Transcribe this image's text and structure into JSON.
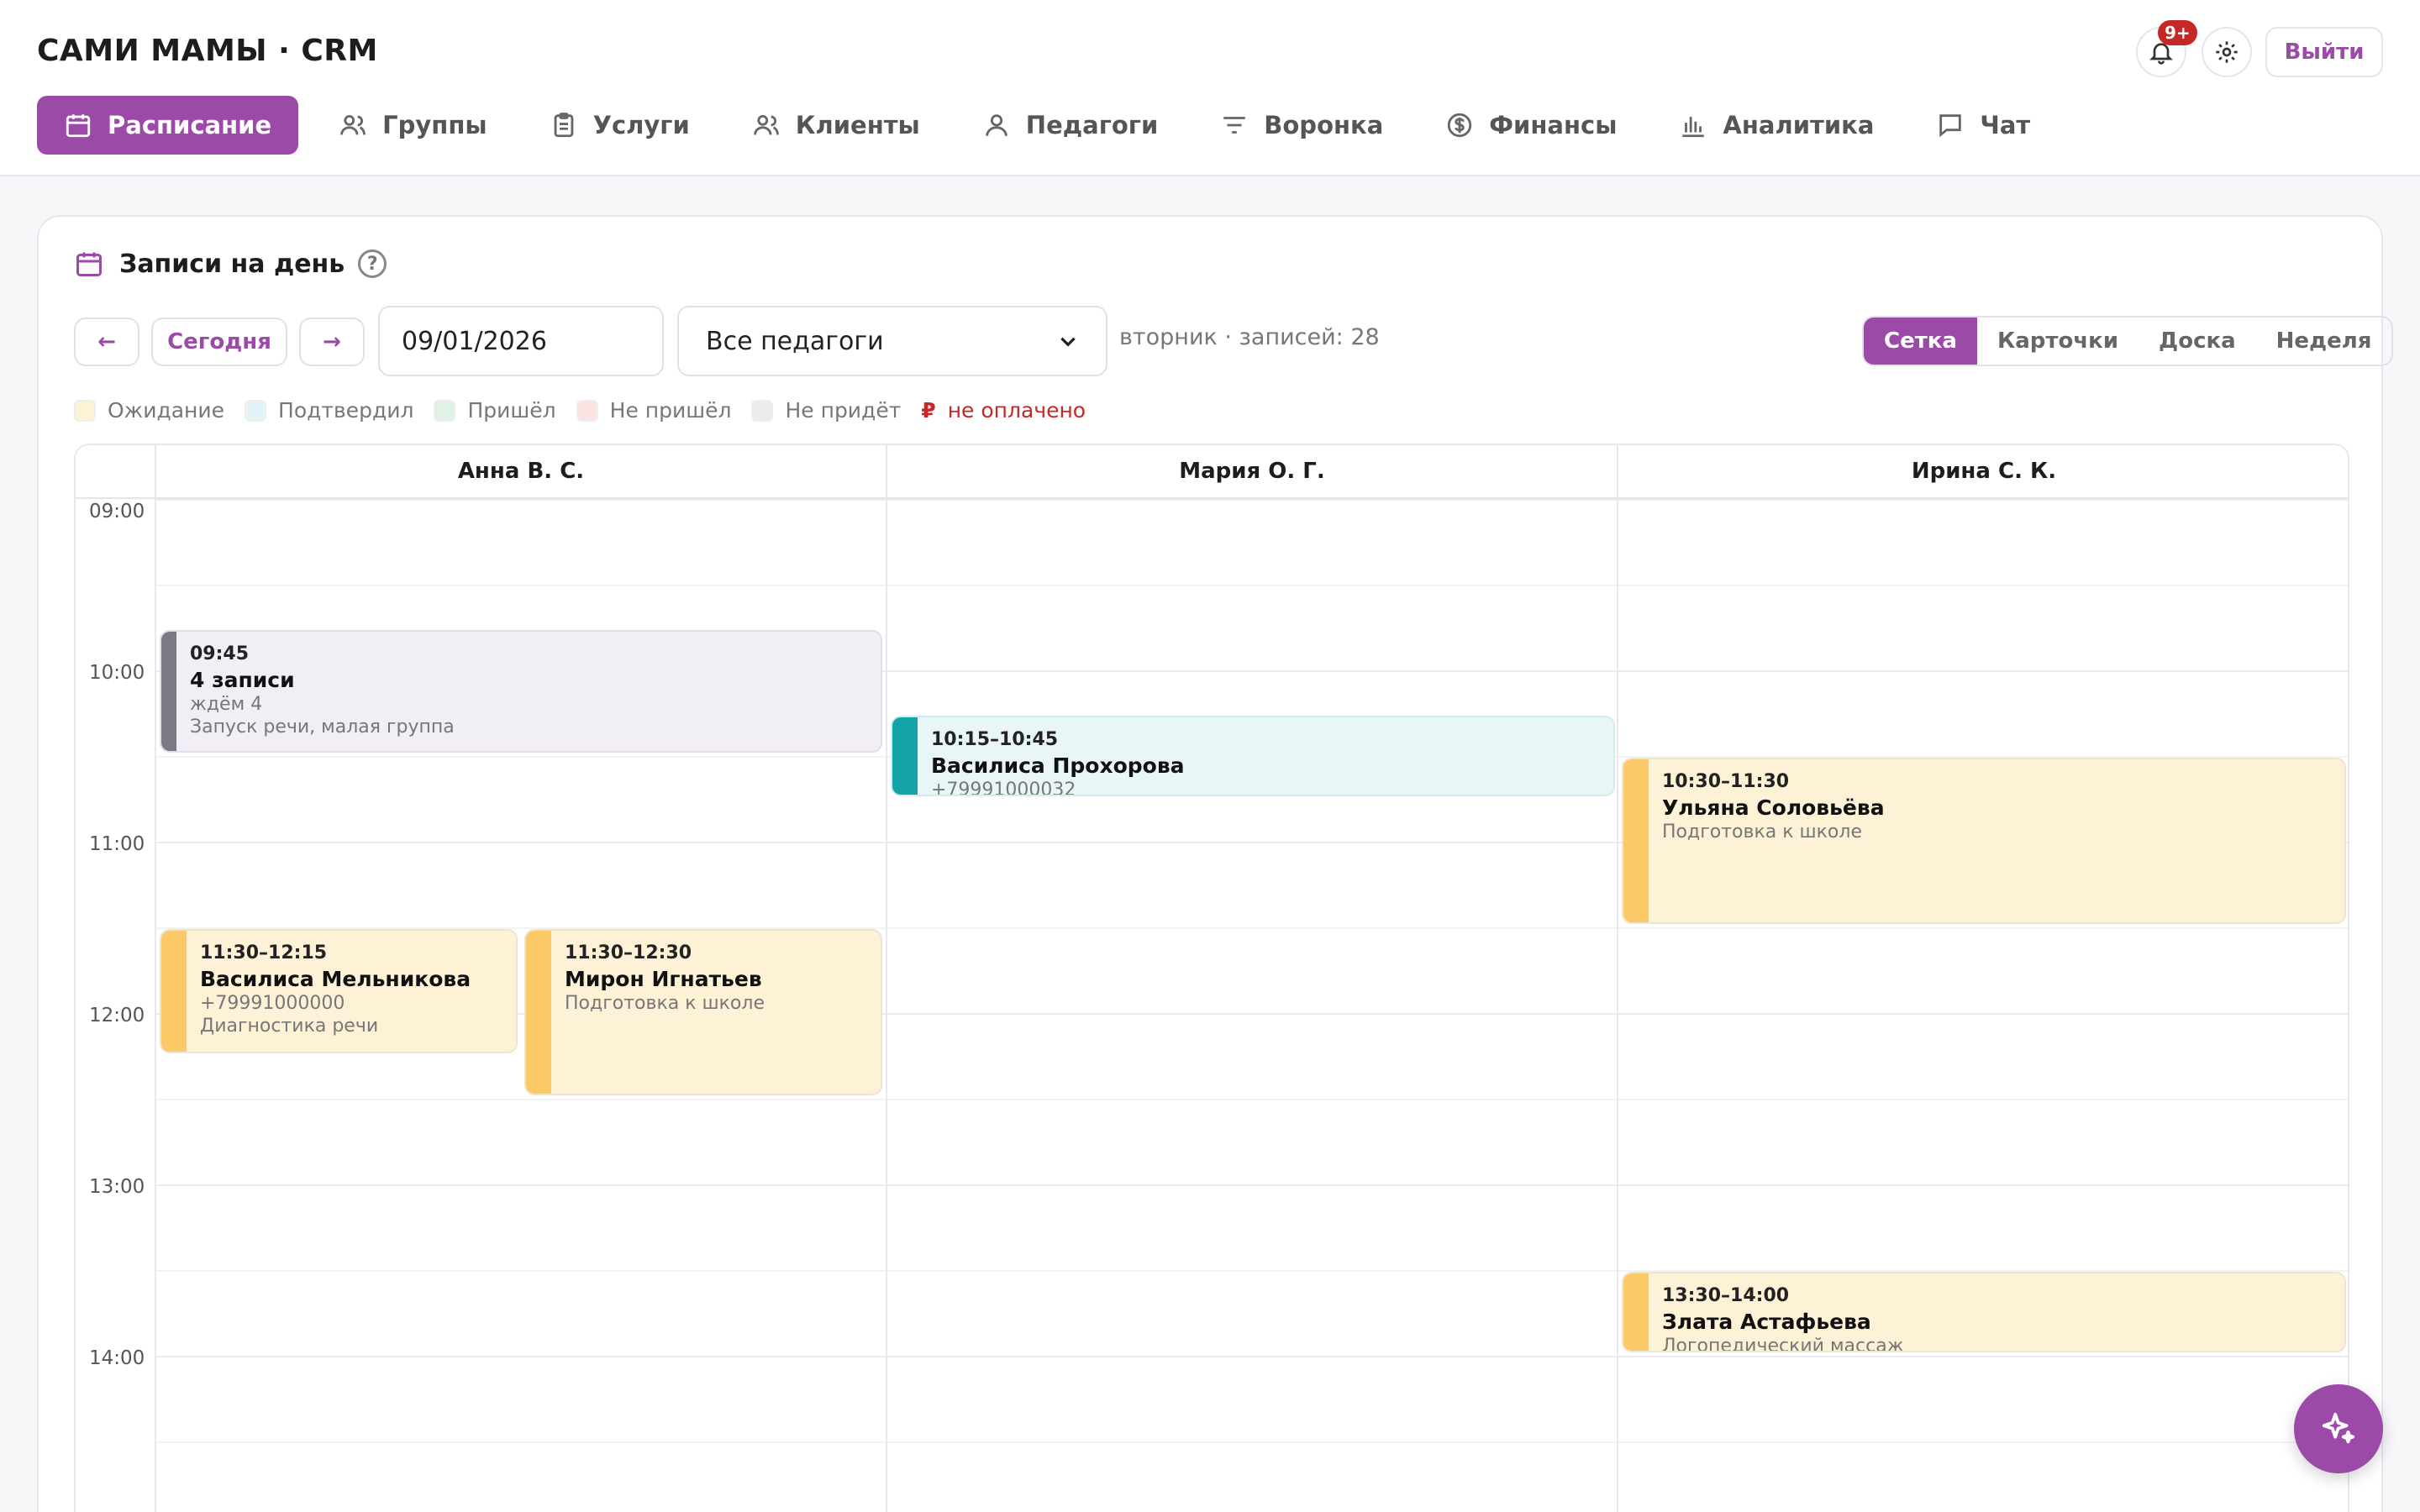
{
  "app": {
    "title": "САМИ МАМЫ · CRM"
  },
  "header": {
    "notifications_badge": "9+",
    "logout_label": "Выйти"
  },
  "nav": [
    {
      "label": "Расписание",
      "icon": "calendar-icon",
      "active": true
    },
    {
      "label": "Группы",
      "icon": "users-icon"
    },
    {
      "label": "Услуги",
      "icon": "clipboard-icon"
    },
    {
      "label": "Клиенты",
      "icon": "users-icon"
    },
    {
      "label": "Педагоги",
      "icon": "user-icon"
    },
    {
      "label": "Воронка",
      "icon": "filter-icon"
    },
    {
      "label": "Финансы",
      "icon": "dollar-icon"
    },
    {
      "label": "Аналитика",
      "icon": "bar-chart-icon"
    },
    {
      "label": "Чат",
      "icon": "chat-icon"
    }
  ],
  "card": {
    "title": "Записи на день",
    "help": "?"
  },
  "controls": {
    "prev": "←",
    "today": "Сегодня",
    "next": "→",
    "date_value": "09/01/2026",
    "teacher_select": "Все педагоги",
    "day_info": "вторник · записей: 28"
  },
  "views": {
    "grid": "Сетка",
    "cards": "Карточки",
    "board": "Доска",
    "week": "Неделя",
    "active": "Сетка"
  },
  "legend": {
    "items": [
      {
        "label": "Ожидание",
        "color": "#fdf1d6"
      },
      {
        "label": "Подтвердил",
        "color": "#e3f4f8"
      },
      {
        "label": "Пришёл",
        "color": "#e0f2e6"
      },
      {
        "label": "Не пришёл",
        "color": "#fbe3e3"
      },
      {
        "label": "Не придёт",
        "color": "#ececec"
      }
    ],
    "unpaid_symbol": "₽",
    "unpaid_label": "не оплачено"
  },
  "schedule": {
    "teachers": [
      "Анна В. С.",
      "Мария О. Г.",
      "Ирина С. К."
    ],
    "hours": [
      "09:00",
      "10:00",
      "11:00",
      "12:00",
      "13:00",
      "14:00"
    ],
    "events": [
      {
        "time": "09:45",
        "title": "4 записи",
        "line1": "ждём 4",
        "line2": "Запуск речи, малая группа",
        "color": "#f2eef5",
        "bar": "#7a7a85"
      },
      {
        "time": "10:15–10:45",
        "title": "Василиса Прохорова",
        "line1": "+79991000032",
        "color": "#e8f6f7",
        "bar": "#14a3a8"
      },
      {
        "time": "10:30–11:30",
        "title": "Ульяна Соловьёва",
        "line1": "Подготовка к школе",
        "color": "#fdf1d6",
        "bar": "#fcc969"
      },
      {
        "time": "11:30–12:15",
        "title": "Василиса Мельникова",
        "line1": "+79991000000",
        "line2": "Диагностика речи",
        "color": "#fdf1d6",
        "bar": "#fcc969"
      },
      {
        "time": "11:30–12:30",
        "title": "Мирон Игнатьев",
        "line1": "Подготовка к школе",
        "color": "#fdf1d6",
        "bar": "#fcc969"
      },
      {
        "time": "13:30–14:00",
        "title": "Злата Астафьева",
        "line1": "Логопедический массаж",
        "color": "#fdf1d6",
        "bar": "#fcc969"
      }
    ]
  },
  "colors": {
    "accent": "#9b4aa8",
    "danger": "#c62828"
  }
}
